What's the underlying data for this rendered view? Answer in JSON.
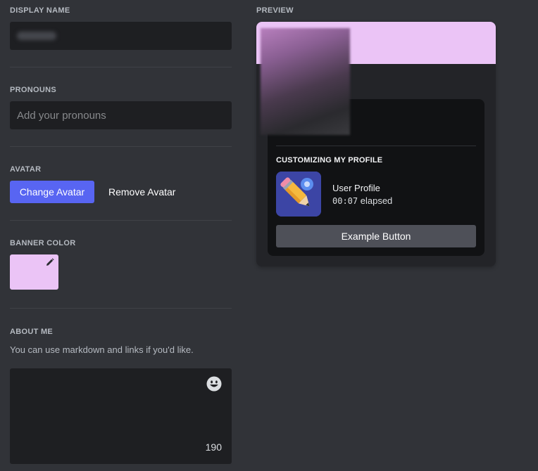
{
  "display_name": {
    "label": "DISPLAY NAME",
    "value": ""
  },
  "pronouns": {
    "label": "PRONOUNS",
    "placeholder": "Add your pronouns"
  },
  "avatar": {
    "label": "AVATAR",
    "change_label": "Change Avatar",
    "remove_label": "Remove Avatar"
  },
  "banner_color": {
    "label": "BANNER COLOR",
    "color": "#ebc4f6"
  },
  "about_me": {
    "label": "ABOUT ME",
    "help": "You can use markdown and links if you'd like.",
    "remaining": "190"
  },
  "preview": {
    "label": "PREVIEW",
    "activity_title": "CUSTOMIZING MY PROFILE",
    "activity_name": "User Profile",
    "elapsed_time": "00:07",
    "elapsed_suffix": " elapsed",
    "button_label": "Example Button"
  },
  "colors": {
    "accent": "#5865f2",
    "banner": "#ebc4f6",
    "background": "#313338"
  }
}
